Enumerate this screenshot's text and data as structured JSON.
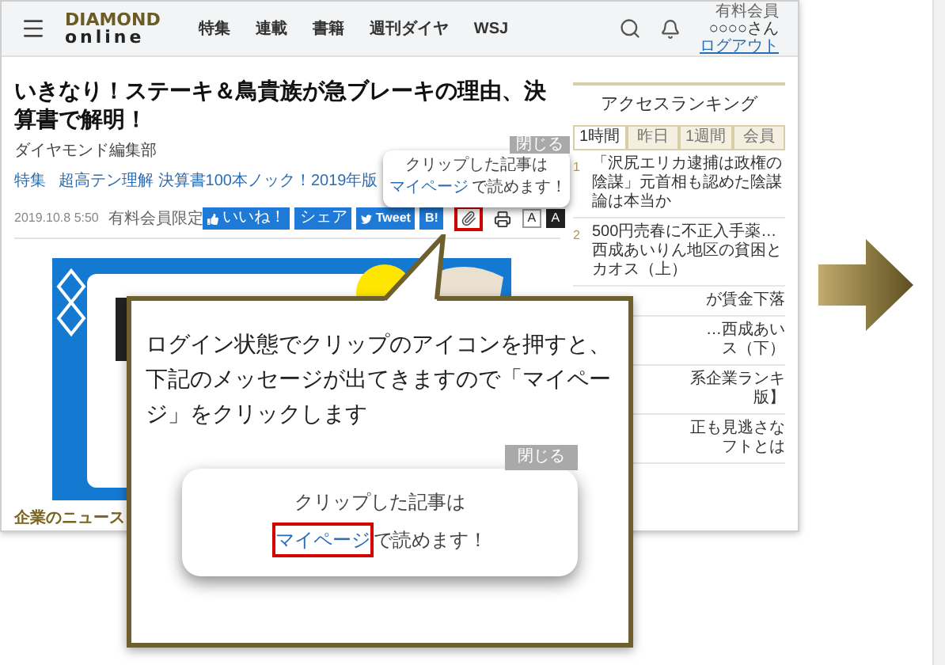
{
  "site": {
    "logo_top": "DIAMOND",
    "logo_bottom": "online",
    "nav": [
      "特集",
      "連載",
      "書籍",
      "週刊ダイヤ",
      "WSJ"
    ],
    "member_label": "有料会員",
    "user": "○○○○さん",
    "logout": "ログアウト"
  },
  "article": {
    "title": "いきなり！ステーキ＆鳥貴族が急ブレーキの理由、決算書で解明！",
    "author": "ダイヤモンド編集部",
    "tag_kind": "特集",
    "tag": "超高テン理解 決算書100本ノック！2019年版",
    "date": "2019.10.8 5:50",
    "access": "有料会員限定",
    "share_buttons": [
      {
        "kind": "like",
        "label": "いいね！"
      },
      {
        "kind": "share",
        "label": "シェア"
      },
      {
        "kind": "tweet",
        "label": "Tweet"
      },
      {
        "kind": "hatena",
        "label": "B!"
      }
    ],
    "clip_highlighted": true,
    "font_buttons": [
      {
        "label": "A",
        "selected": false
      },
      {
        "label": "A",
        "selected": true
      }
    ],
    "footer_text": "企業のニュース"
  },
  "clip_popup": {
    "close": "閉じる",
    "line1": "クリップした記事は",
    "link": "マイページ",
    "rest": "で読めます！",
    "link_highlighted": false
  },
  "ranking": {
    "title": "アクセスランキング",
    "tabs": [
      {
        "label": "1時間",
        "selected": true
      },
      {
        "label": "昨日",
        "selected": false
      },
      {
        "label": "1週間",
        "selected": false
      },
      {
        "label": "会員",
        "selected": false
      }
    ],
    "items": [
      {
        "rank": "1",
        "lines": [
          "「沢尻エリカ逮捕は政権の陰謀」元首相も認めた陰謀論は本当か"
        ]
      },
      {
        "rank": "2",
        "lines": [
          "500円売春に不正入手薬…西成あいりん地区の貧困とカオス（上）"
        ]
      },
      {
        "lines": [
          "が賃金下落"
        ]
      },
      {
        "lines": [
          "…西成あい",
          "ス（下）"
        ]
      },
      {
        "lines": [
          "系企業ランキ",
          "版】"
        ]
      },
      {
        "lines": [
          "正も見逃さな",
          "フトとは"
        ]
      }
    ]
  },
  "callout": {
    "text": "ログイン状態でクリップのアイコンを押すと、下記のメッセージが出てきますので「マイページ」をクリックします",
    "popup": {
      "close": "閉じる",
      "line1": "クリップした記事は",
      "link": "マイページ",
      "rest": "で読めます！",
      "link_highlighted": true
    }
  }
}
